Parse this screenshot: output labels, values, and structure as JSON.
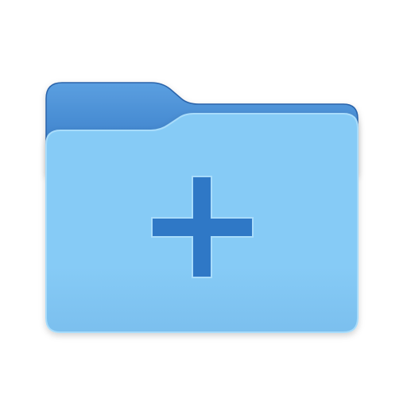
{
  "icon": {
    "name": "new-folder-icon",
    "symbol": "plus",
    "colors": {
      "back_panel_top": "#5b9fe0",
      "back_panel_bottom": "#2f74c2",
      "back_panel_stroke": "#2a64aa",
      "front_panel_top": "#86cbf6",
      "front_panel_bottom": "#7bbfee",
      "front_panel_stroke": "#a8dcfb",
      "plus_fill": "#2f78c6",
      "plus_stroke": "#a8dcfb"
    }
  }
}
